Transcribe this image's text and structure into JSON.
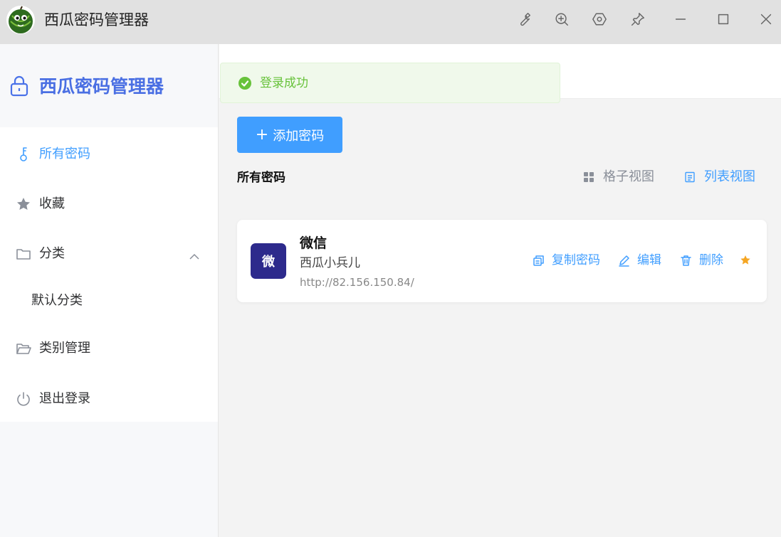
{
  "window": {
    "title": "西瓜密码管理器",
    "logo_icon": "watermelon-icon",
    "controls": [
      "wrench-icon",
      "zoom-in-icon",
      "settings-hexagon-icon",
      "pin-icon",
      "minimize-icon",
      "maximize-icon",
      "close-icon"
    ]
  },
  "sidebar": {
    "brand": "西瓜密码管理器",
    "brand_icon": "lock-icon",
    "items": [
      {
        "label": "所有密码",
        "icon": "key-icon",
        "active": true
      },
      {
        "label": "收藏",
        "icon": "star-icon"
      },
      {
        "label": "分类",
        "icon": "folder-icon",
        "expanded": true
      },
      {
        "label": "默认分类",
        "icon": ""
      },
      {
        "label": "类别管理",
        "icon": "folder-open-icon"
      },
      {
        "label": "退出登录",
        "icon": "power-icon"
      }
    ]
  },
  "toast": {
    "message": "登录成功",
    "icon": "success-check-icon",
    "color": "#67c23a"
  },
  "main": {
    "add_button": "添加密码",
    "section_title": "所有密码",
    "grid_view": "格子视图",
    "list_view": "列表视图"
  },
  "entries": [
    {
      "avatar": "微",
      "avatar_color": "#2d2a8c",
      "name": "微信",
      "username": "西瓜小兵儿",
      "url": "http://82.156.150.84/",
      "actions": {
        "copy": "复制密码",
        "edit": "编辑",
        "delete": "删除"
      },
      "favorite": true
    }
  ],
  "colors": {
    "accent": "#409eff",
    "brand": "#4a6fe3",
    "success": "#67c23a",
    "star": "#f5a623"
  }
}
